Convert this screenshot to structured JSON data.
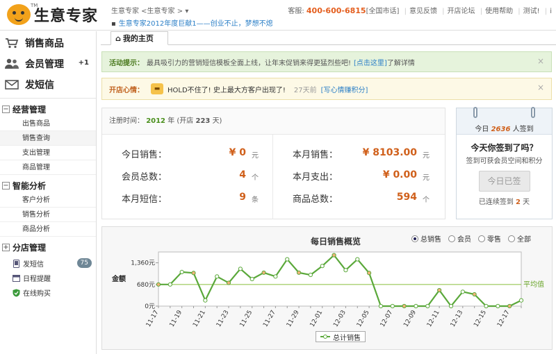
{
  "header": {
    "logo_text": "生意专家",
    "logo_tm": "TM",
    "breadcrumb": "生意专家 <生意专家 >",
    "announcement": "生意专家2012年度巨献1——创业不止，梦想不熄",
    "service_label": "客服:",
    "phone": "400-600-6815",
    "region": "[全国市话]",
    "links": [
      "意见反馈",
      "开店论坛",
      "使用帮助",
      "测试!",
      "i"
    ]
  },
  "sidebar": {
    "main_items": [
      {
        "label": "销售商品",
        "icon": "cart-icon"
      },
      {
        "label": "会员管理",
        "icon": "members-icon",
        "extra": "+1"
      },
      {
        "label": "发短信",
        "icon": "envelope-icon"
      }
    ],
    "groups": [
      {
        "label": "经营管理",
        "marker": "−",
        "items": [
          "出售商品",
          "销售查询",
          "支出管理",
          "商品管理"
        ]
      },
      {
        "label": "智能分析",
        "marker": "−",
        "items": [
          "客户分析",
          "销售分析",
          "商品分析"
        ]
      },
      {
        "label": "分店管理",
        "marker": "+",
        "items": []
      }
    ],
    "tools": [
      {
        "label": "发短信",
        "icon": "phone-icon",
        "badge": "75"
      },
      {
        "label": "日程提醒",
        "icon": "calendar-icon"
      },
      {
        "label": "在线购买",
        "icon": "shield-icon"
      }
    ]
  },
  "tabs": {
    "home": "我的主页",
    "home_icon": "⌂"
  },
  "notices": {
    "activity_label": "活动提示：",
    "activity_text": "最具吸引力的营销短信模板全面上线，让年末促销来得更猛烈些吧!",
    "activity_link": "[点击这里]",
    "activity_suffix": "了解详情",
    "mood_label": "开店心情：",
    "mood_text": "HOLD不住了! 史上最大方客户出现了!",
    "mood_time": "27天前",
    "mood_link": "[写心情赚积分]",
    "close": "×"
  },
  "stats": {
    "reg_label": "注册时间：",
    "reg_year": "2012",
    "reg_year_unit": "年 (开店",
    "reg_days": "223",
    "reg_days_unit": "天)",
    "today_sales_label": "今日销售：",
    "today_sales_value": "¥ 0",
    "today_sales_unit": "元",
    "members_label": "会员总数：",
    "members_value": "4",
    "members_unit": "个",
    "sms_label": "本月短信：",
    "sms_value": "9",
    "sms_unit": "条",
    "month_sales_label": "本月销售：",
    "month_sales_value": "¥ 8103.00",
    "month_sales_unit": "元",
    "month_expense_label": "本月支出：",
    "month_expense_value": "¥ 0.00",
    "month_expense_unit": "元",
    "products_label": "商品总数：",
    "products_value": "594",
    "products_unit": "个"
  },
  "signin": {
    "today_prefix": "今日",
    "today_count": "2636",
    "today_suffix": "人签到",
    "question": "今天你签到了吗？",
    "sub": "签到可获会员空间和积分",
    "button": "今日已签",
    "days_prefix": "已连续签到",
    "days_count": "2",
    "days_suffix": "天"
  },
  "chart_options": {
    "options": [
      "总销售",
      "会员",
      "零售",
      "全部"
    ],
    "selected": "总销售"
  },
  "chart_data": {
    "type": "line",
    "title": "每日销售概览",
    "ylabel": "金额",
    "ylim": [
      0,
      1360
    ],
    "yticks": [
      "0元",
      "680元",
      "1,360元"
    ],
    "ytick_values": [
      0,
      680,
      1360
    ],
    "x": [
      "11-17",
      "11-18",
      "11-19",
      "11-20",
      "11-21",
      "11-22",
      "11-23",
      "11-24",
      "11-25",
      "11-26",
      "11-27",
      "11-28",
      "11-29",
      "11-30",
      "12-01",
      "12-02",
      "12-03",
      "12-04",
      "12-05",
      "12-06",
      "12-07",
      "12-08",
      "12-09",
      "12-10",
      "12-11",
      "12-12",
      "12-13",
      "12-14",
      "12-15",
      "12-16",
      "12-17",
      "12-18"
    ],
    "xtick_labels": [
      "11-17",
      "11-19",
      "11-21",
      "11-23",
      "11-25",
      "11-27",
      "11-29",
      "12-01",
      "12-03",
      "12-05",
      "12-07",
      "12-09",
      "12-11",
      "12-13",
      "12-15",
      "12-17"
    ],
    "series": [
      {
        "name": "总计销售",
        "values": [
          680,
          680,
          1070,
          1040,
          180,
          930,
          730,
          1170,
          850,
          1050,
          930,
          1470,
          1050,
          980,
          1260,
          1600,
          1130,
          1470,
          1040,
          0,
          0,
          0,
          0,
          0,
          500,
          0,
          450,
          370,
          0,
          0,
          0,
          180
        ]
      }
    ],
    "average_line": {
      "label": "平均值",
      "value": 680
    },
    "colors": {
      "line": "#5aa83a",
      "marker_fill": "#ffffff",
      "marker_alt": "#f2b27a",
      "average": "#a8d070",
      "avg_label": "#6aa52a"
    }
  }
}
